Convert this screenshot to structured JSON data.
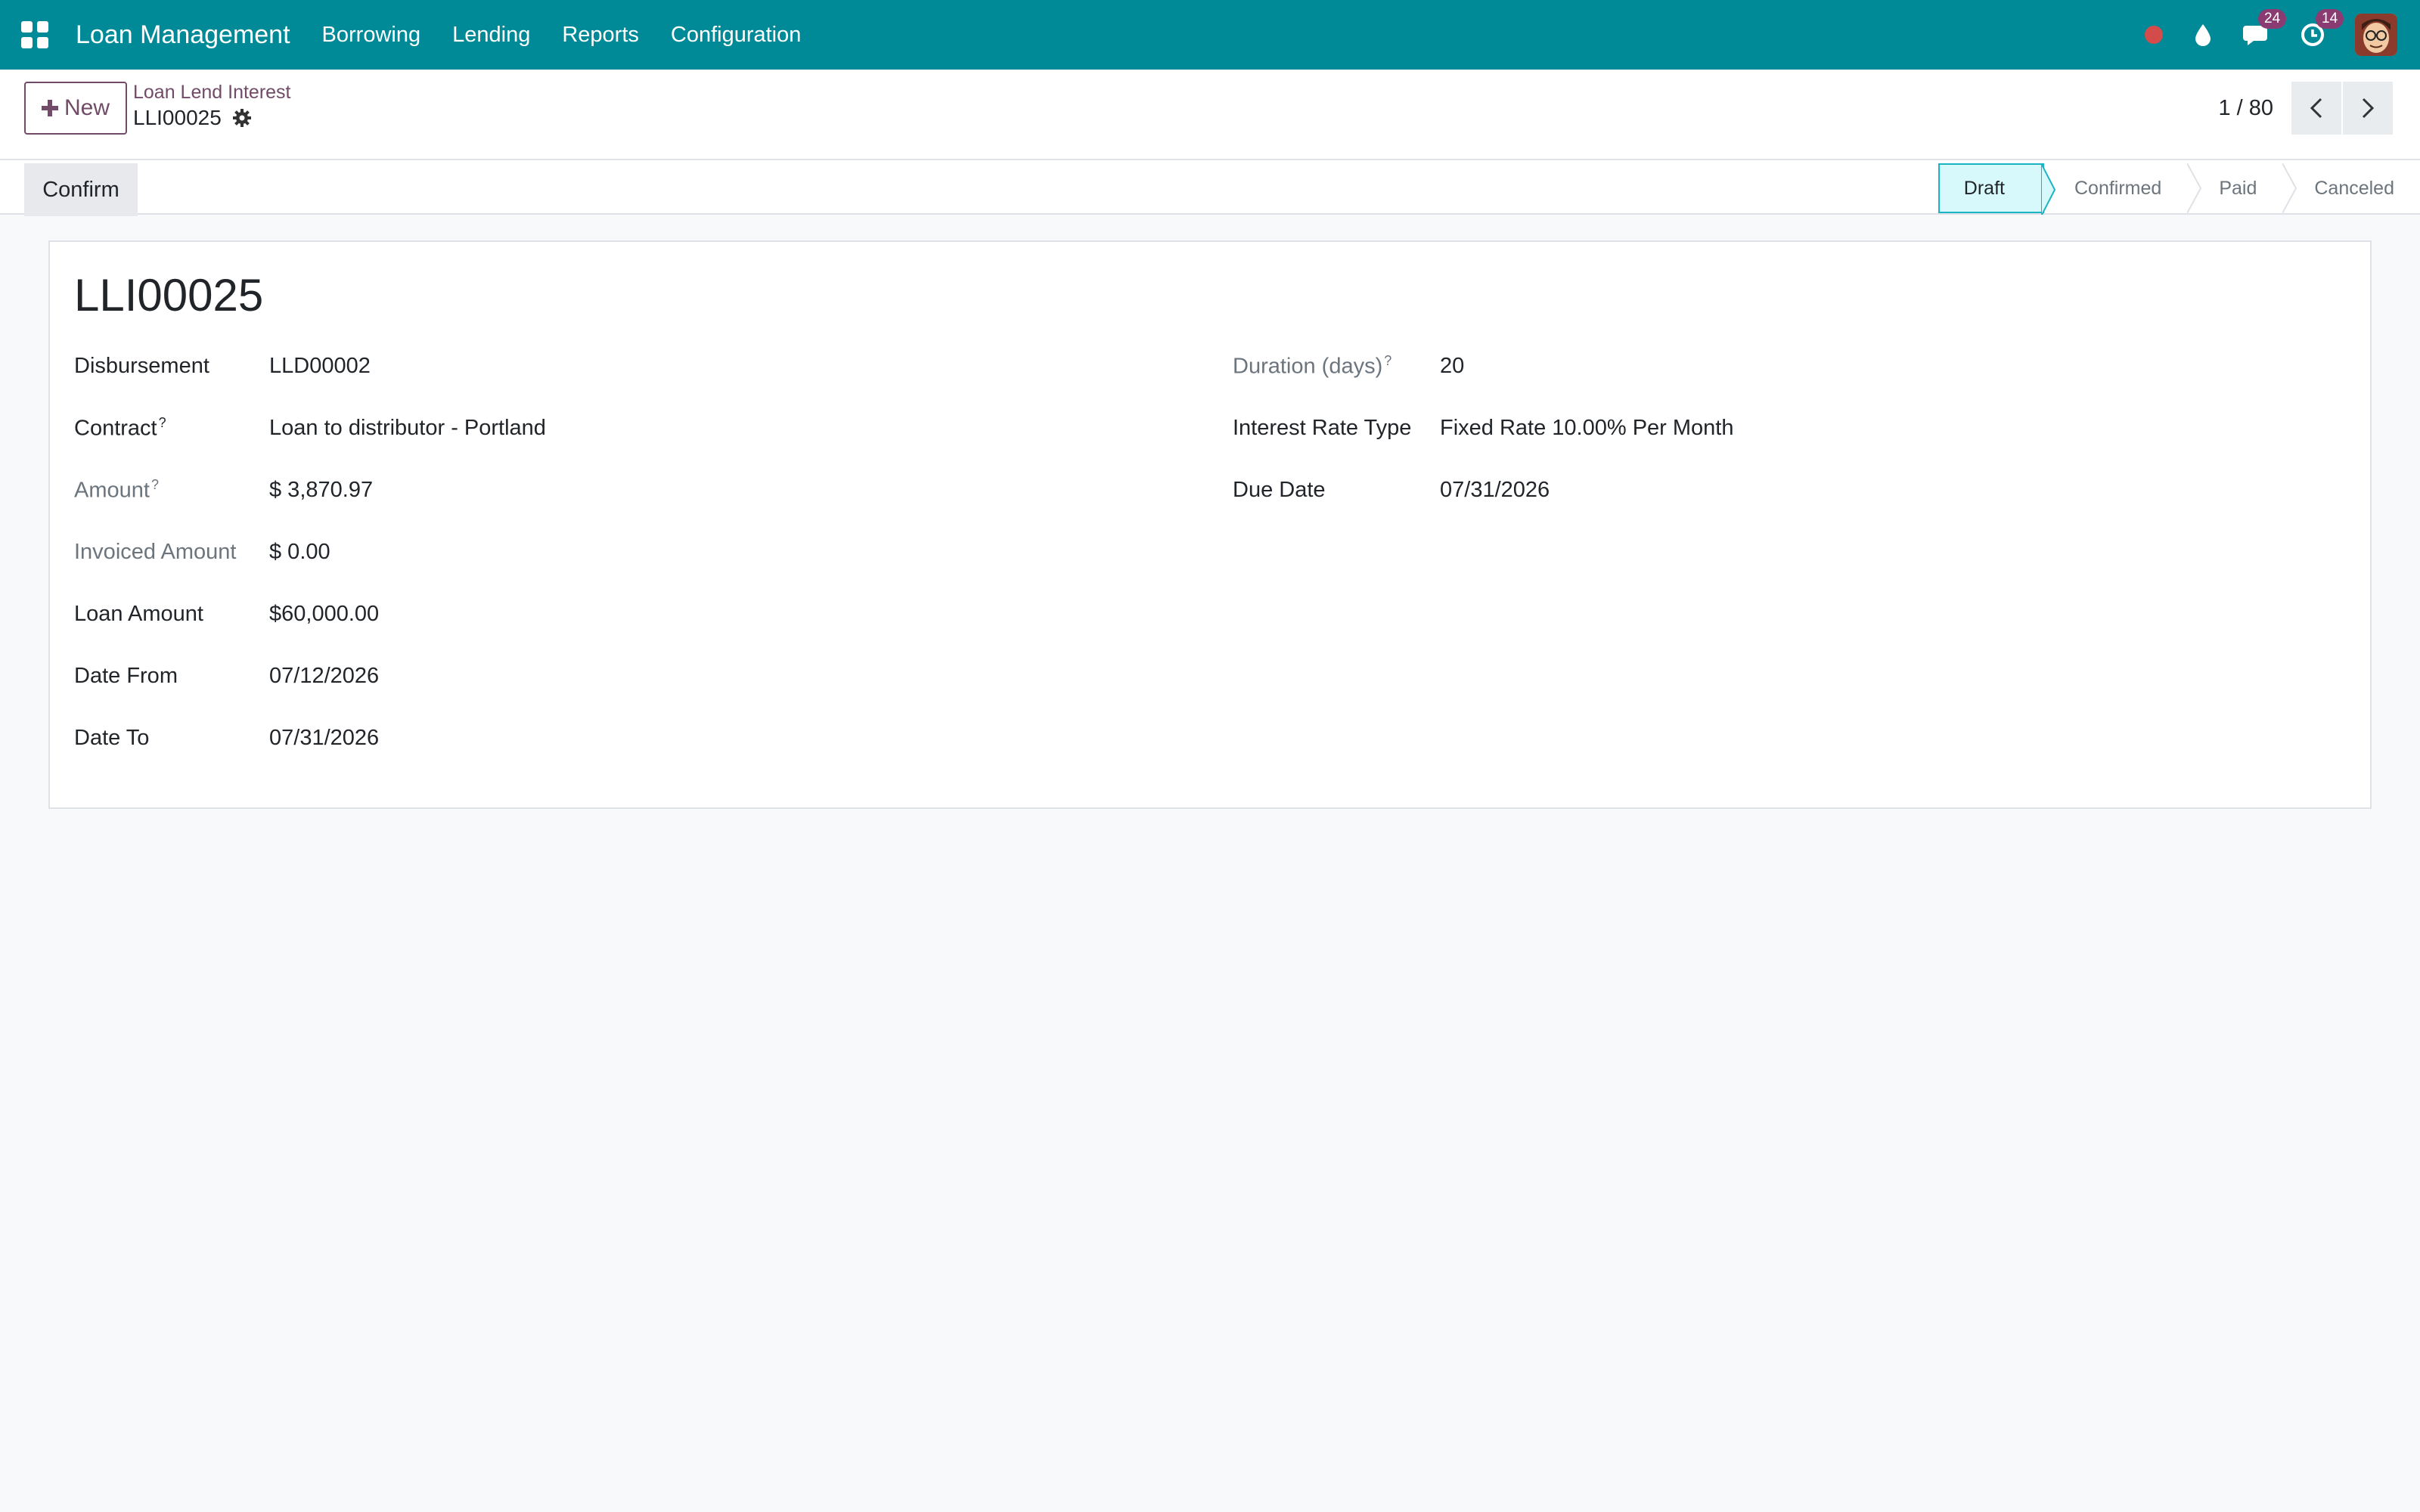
{
  "navbar": {
    "app_title": "Loan Management",
    "menu": [
      "Borrowing",
      "Lending",
      "Reports",
      "Configuration"
    ],
    "messages_count": "24",
    "activities_count": "14",
    "bg_color": "#008a98"
  },
  "control_panel": {
    "new_label": "New",
    "breadcrumb_parent": "Loan Lend Interest",
    "record_name": "LLI00025",
    "pager_value": "1 / 80"
  },
  "statusbar": {
    "confirm_label": "Confirm",
    "stages": [
      "Draft",
      "Confirmed",
      "Paid",
      "Canceled"
    ],
    "active_stage": "Draft"
  },
  "form": {
    "title": "LLI00025",
    "left_fields": [
      {
        "label": "Disbursement",
        "value": "LLD00002",
        "help": "",
        "muted": false
      },
      {
        "label": "Contract",
        "value": "Loan to distributor - Portland",
        "help": "?",
        "muted": false
      },
      {
        "label": "Amount",
        "value": "$ 3,870.97",
        "help": "?",
        "muted": true
      },
      {
        "label": "Invoiced Amount",
        "value": "$ 0.00",
        "help": "",
        "muted": true
      },
      {
        "label": "Loan Amount",
        "value": "$60,000.00",
        "help": "",
        "muted": false
      },
      {
        "label": "Date From",
        "value": "07/12/2026",
        "help": "",
        "muted": false
      },
      {
        "label": "Date To",
        "value": "07/31/2026",
        "help": "",
        "muted": false
      }
    ],
    "right_fields": [
      {
        "label": "Duration (days)",
        "value": "20",
        "help": "?",
        "muted": true
      },
      {
        "label": "Interest Rate Type",
        "value": "Fixed Rate 10.00% Per Month",
        "help": "",
        "muted": false
      },
      {
        "label": "Due Date",
        "value": "07/31/2026",
        "help": "",
        "muted": false
      }
    ]
  }
}
